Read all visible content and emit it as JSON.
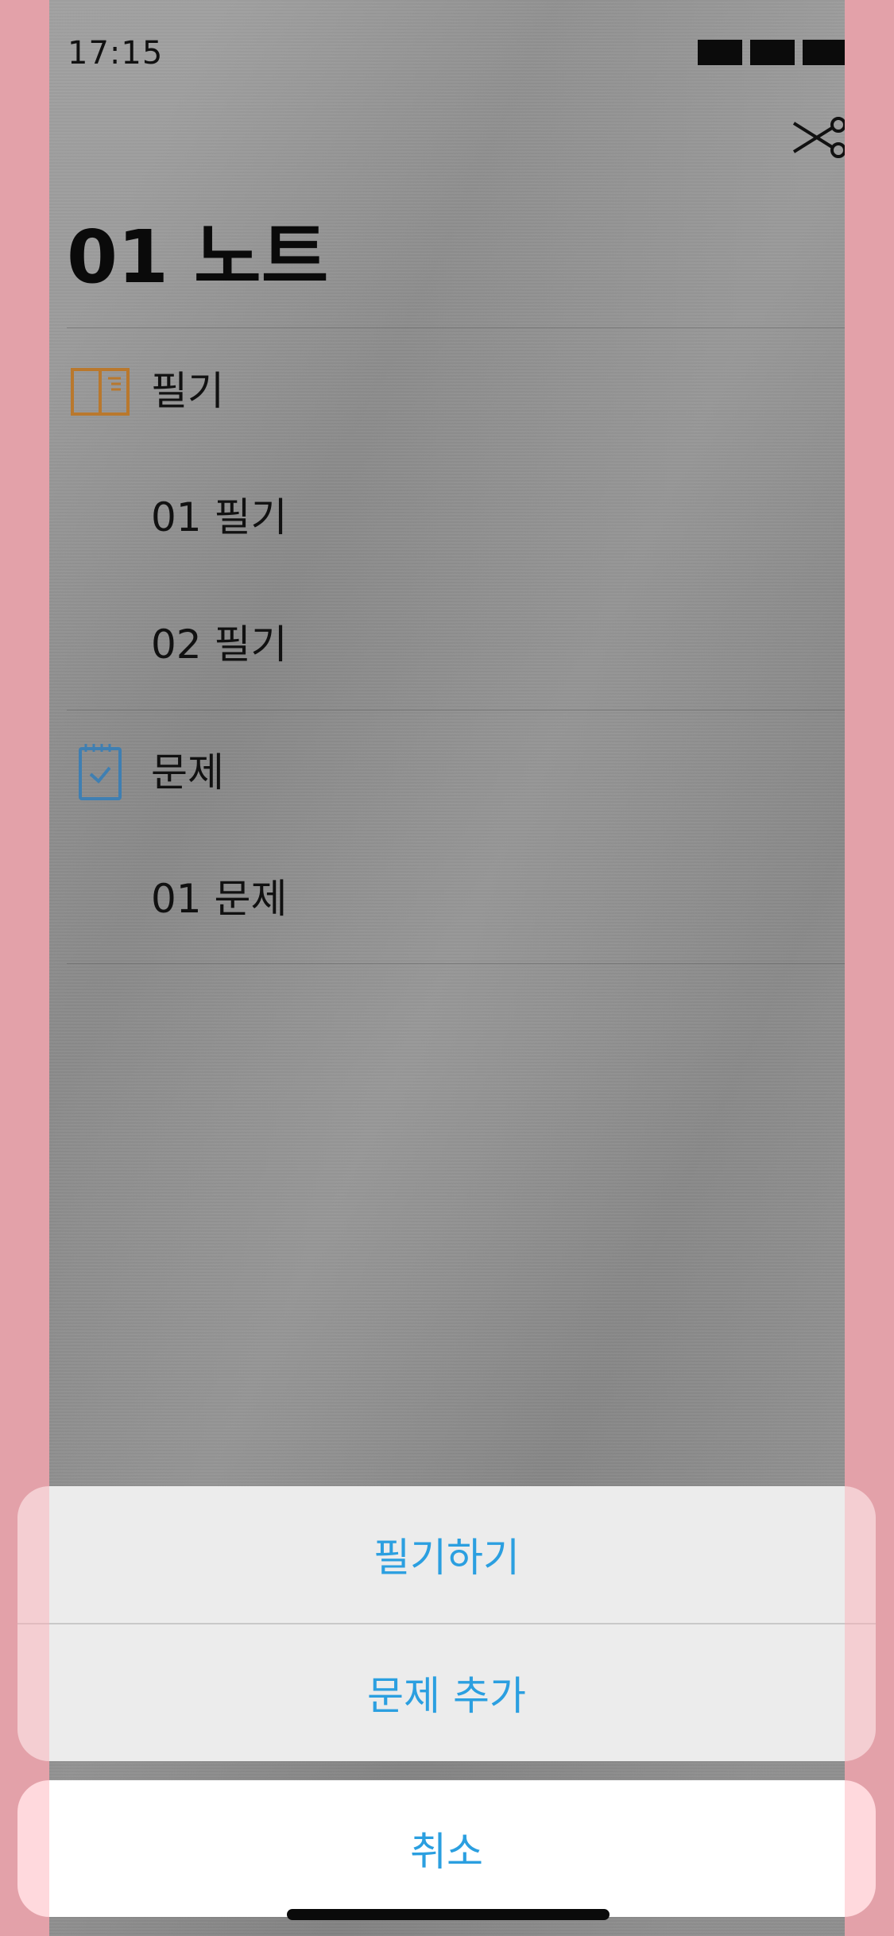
{
  "status_bar": {
    "time": "17:15"
  },
  "header": {
    "title": "01 노트",
    "action_icon": "scissors-icon"
  },
  "sections": [
    {
      "icon": "book-icon",
      "icon_color": "#b9782d",
      "label": "필기",
      "items": [
        "01 필기",
        "02 필기"
      ]
    },
    {
      "icon": "notepad-check-icon",
      "icon_color": "#3f7fb2",
      "label": "문제",
      "items": [
        "01 문제"
      ]
    }
  ],
  "action_sheet": {
    "options": [
      "필기하기",
      "문제 추가"
    ],
    "cancel_label": "취소",
    "accent_color": "#2b9fe0"
  }
}
